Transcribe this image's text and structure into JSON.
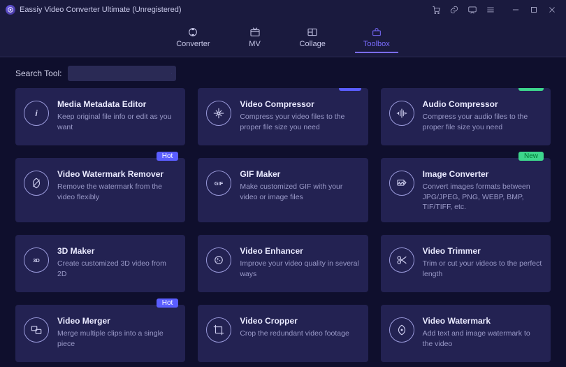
{
  "app": {
    "title": "Eassiy Video Converter Ultimate (Unregistered)"
  },
  "tabs": [
    {
      "label": "Converter"
    },
    {
      "label": "MV"
    },
    {
      "label": "Collage"
    },
    {
      "label": "Toolbox"
    }
  ],
  "search": {
    "label": "Search Tool:",
    "value": ""
  },
  "badges": {
    "hot": "Hot",
    "new": "New"
  },
  "tools": [
    {
      "title": "Media Metadata Editor",
      "desc": "Keep original file info or edit as you want",
      "icon": "info",
      "badge": null
    },
    {
      "title": "Video Compressor",
      "desc": "Compress your video files to the proper file size you need",
      "icon": "compress-video",
      "badge": "hot"
    },
    {
      "title": "Audio Compressor",
      "desc": "Compress your audio files to the proper file size you need",
      "icon": "compress-audio",
      "badge": "new"
    },
    {
      "title": "Video Watermark Remover",
      "desc": "Remove the watermark from the video flexibly",
      "icon": "watermark-remove",
      "badge": "hot"
    },
    {
      "title": "GIF Maker",
      "desc": "Make customized GIF with your video or image files",
      "icon": "gif",
      "badge": null
    },
    {
      "title": "Image Converter",
      "desc": "Convert images formats between JPG/JPEG, PNG, WEBP, BMP, TIF/TIFF, etc.",
      "icon": "image-convert",
      "badge": "new"
    },
    {
      "title": "3D Maker",
      "desc": "Create customized 3D video from 2D",
      "icon": "3d",
      "badge": null
    },
    {
      "title": "Video Enhancer",
      "desc": "Improve your video quality in several ways",
      "icon": "enhancer",
      "badge": null
    },
    {
      "title": "Video Trimmer",
      "desc": "Trim or cut your videos to the perfect length",
      "icon": "trimmer",
      "badge": null
    },
    {
      "title": "Video Merger",
      "desc": "Merge multiple clips into a single piece",
      "icon": "merger",
      "badge": "hot"
    },
    {
      "title": "Video Cropper",
      "desc": "Crop the redundant video footage",
      "icon": "cropper",
      "badge": null
    },
    {
      "title": "Video Watermark",
      "desc": "Add text and image watermark to the video",
      "icon": "watermark",
      "badge": null
    }
  ]
}
